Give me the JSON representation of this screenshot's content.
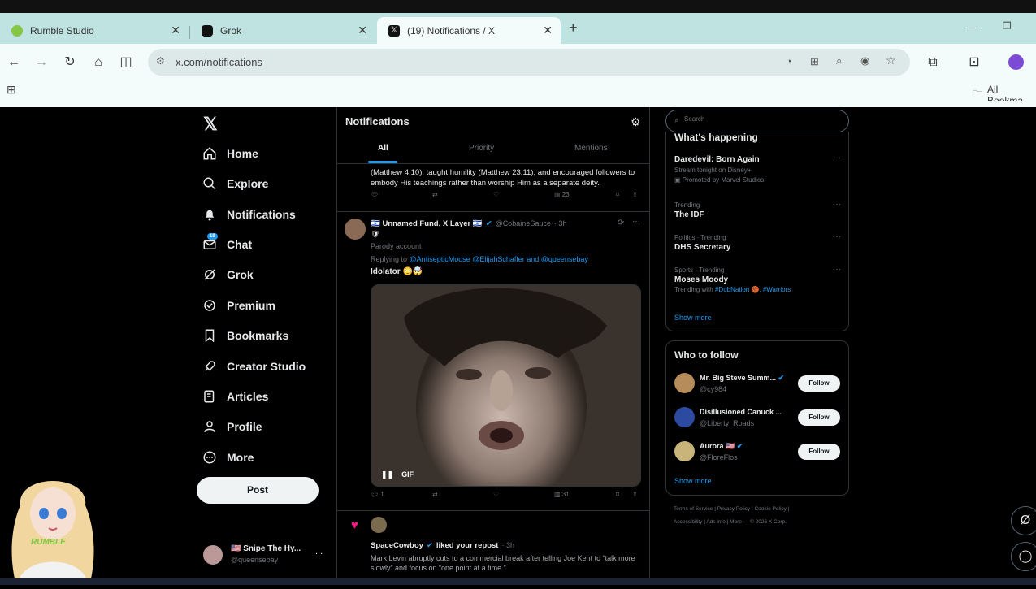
{
  "browser": {
    "tabs": [
      {
        "title": "Rumble Studio",
        "icon": "rumble-icon",
        "active": false
      },
      {
        "title": "Grok",
        "icon": "grok-icon",
        "active": false
      },
      {
        "title": "(19) Notifications / X",
        "icon": "x-logo-icon",
        "active": true
      }
    ],
    "new_tab": "+",
    "url": "x.com/notifications",
    "bookmarks_label": "All Bookma"
  },
  "sidebar": {
    "items": [
      {
        "label": "Home",
        "icon": "home-icon"
      },
      {
        "label": "Explore",
        "icon": "search-icon"
      },
      {
        "label": "Notifications",
        "icon": "bell-icon"
      },
      {
        "label": "Chat",
        "icon": "mail-icon",
        "badge": "19"
      },
      {
        "label": "Grok",
        "icon": "grok-icon"
      },
      {
        "label": "Premium",
        "icon": "premium-icon"
      },
      {
        "label": "Bookmarks",
        "icon": "bookmark-icon"
      },
      {
        "label": "Creator Studio",
        "icon": "rocket-icon"
      },
      {
        "label": "Articles",
        "icon": "article-icon"
      },
      {
        "label": "Profile",
        "icon": "person-icon"
      },
      {
        "label": "More",
        "icon": "more-circle-icon"
      }
    ],
    "post_label": "Post",
    "account": {
      "name": "🇺🇸 Snipe The Hy...",
      "handle": "@queensebay",
      "menu": "..."
    }
  },
  "main": {
    "title": "Notifications",
    "tabs": [
      "All",
      "Priority",
      "Mentions"
    ],
    "first_post_text": "(Matthew 4:10), taught humility (Matthew 23:11), and encouraged followers to embody His teachings rather than worship Him as a separate deity.",
    "first_post_views": "23",
    "post2": {
      "name": "🇮🇱 Unnamed Fund, X Layer 🇮🇱",
      "handle": "@CobaineSauce",
      "time": "· 3h",
      "extra": "🛡",
      "parody": "Parody account",
      "replying_prefix": "Replying to",
      "replying_to": "@AntisepticMoose @ElijahSchaffer and @queensebay",
      "text": "Idolator 😳🤯",
      "gif_label": "GIF",
      "replies": "1",
      "views": "31"
    },
    "post3": {
      "name": "SpaceCowboy",
      "action": "liked your repost",
      "time": "· 3h",
      "text": "Mark Levin abruptly cuts to a commercial break after telling Joe Kent to “talk more slowly” and focus on “one point at a time.”"
    }
  },
  "right": {
    "search_placeholder": "Search",
    "happening_title": "What's happening",
    "trends": [
      {
        "meta": "",
        "title": "Daredevil: Born Again",
        "sub": "Stream tonight on Disney+",
        "promo": "Promoted by Marvel Studios"
      },
      {
        "meta": "Trending",
        "title": "The IDF",
        "sub": "",
        "promo": ""
      },
      {
        "meta": "Politics · Trending",
        "title": "DHS Secretary",
        "sub": "",
        "promo": ""
      },
      {
        "meta": "Sports · Trending",
        "title": "Moses Moody",
        "sub": "Trending with",
        "tags": "#DubNation 🏀, #Warriors"
      }
    ],
    "show_more": "Show more",
    "who_to_follow_title": "Who to follow",
    "follow_list": [
      {
        "name": "Mr. Big Steve Summ...",
        "handle": "@cy984",
        "button": "Follow"
      },
      {
        "name": "Disillusioned Canuck ...",
        "handle": "@Liberty_Roads",
        "button": "Follow"
      },
      {
        "name": "Aurora 🇺🇸",
        "handle": "@FloreFlos",
        "button": "Follow"
      }
    ],
    "footer_line1": "Terms of Service  |  Privacy Policy  |  Cookie Policy  |",
    "footer_line2": "Accessibility  |  Ads info  |  More ···  © 2026 X Corp."
  },
  "overlay": {
    "mascot_text": "RUMBLE"
  }
}
